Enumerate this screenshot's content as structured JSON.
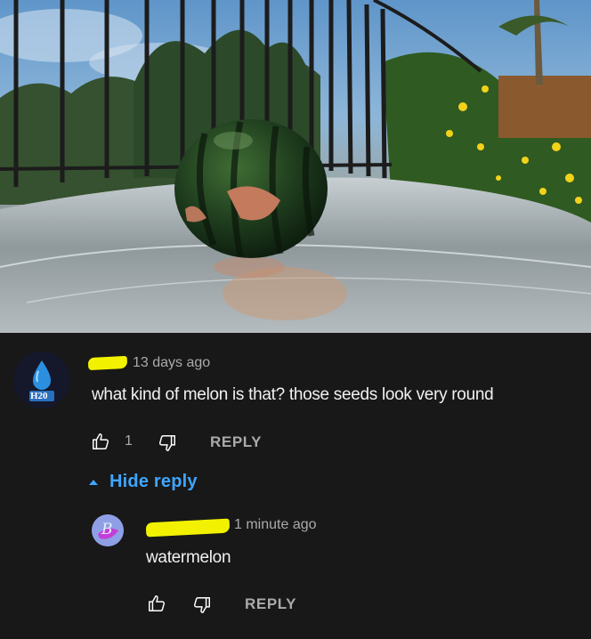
{
  "comment": {
    "avatar_text": "H20",
    "timestamp": "13 days ago",
    "text": "what kind of melon is that? those seeds look very round",
    "like_count": "1",
    "reply_label": "REPLY"
  },
  "replies_toggle": {
    "label": "Hide reply"
  },
  "reply": {
    "timestamp": "1 minute ago",
    "text": "watermelon",
    "reply_label": "REPLY"
  },
  "colors": {
    "background": "#181818",
    "link_blue": "#3ea6ff",
    "meta_gray": "#aaaaaa",
    "highlighter_yellow": "#f2f200"
  },
  "icons": [
    "thumbs-up-icon",
    "thumbs-down-icon",
    "caret-up-icon",
    "water-drop-icon"
  ]
}
